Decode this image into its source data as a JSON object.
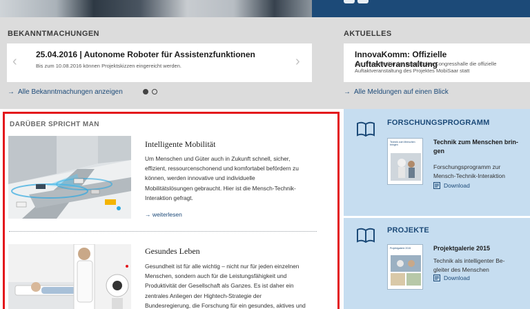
{
  "announcements": {
    "heading": "BEKANNTMACHUNGEN",
    "card_title": "25.04.2016 |  Autonome Roboter für Assistenzfunktionen",
    "card_subtitle": "Bis zum 10.08.2016 können Projektskizzen eingereicht werden.",
    "prev_icon": "chevron-left-icon",
    "next_icon": "chevron-right-icon",
    "prev_glyph": "‹",
    "next_glyph": "›",
    "all_link": "Alle Bekanntmachungen anzeigen",
    "slides_total": 2,
    "slide_active": 1
  },
  "news": {
    "heading": "AKTUELLES",
    "card_title": "InnovaKomm: Offizielle Auftaktveranstaltung",
    "card_subtitle_1": "Am 2. Mai fand in der Saarbrücker Congresshalle die offizielle",
    "card_subtitle_2": "Auftaktveranstaltung des Projektes MobiSaar statt",
    "all_link": "Alle Meldungen auf einen Blick"
  },
  "talk": {
    "heading": "DARÜBER SPRICHT MAN",
    "articles": [
      {
        "title": "Intelligente Mobilität",
        "lines": [
          "Um Menschen und Güter auch in Zukunft schnell, sicher,",
          "effizient, ressourcenschonend und komfortabel befördern zu",
          "können, werden innovative und individuelle",
          "Mobilitätslösungen gebraucht. Hier ist die Mensch-Technik-",
          "Interaktion gefragt."
        ],
        "more": "weiterlesen"
      },
      {
        "title": "Gesundes Leben",
        "lines": [
          "Gesundheit ist für alle wichtig – nicht nur für jeden einzelnen",
          "Menschen, sondern auch für die Leistungsfähigkeit und",
          "Produktivität der Gesellschaft als Ganzes. Es ist daher ein",
          "zentrales Anliegen der Hightech-Strategie der",
          "Bundesregierung, die Forschung für ein gesundes, aktives und"
        ]
      }
    ]
  },
  "sidebar": {
    "program": {
      "heading": "FORSCHUNGSPROGRAMM",
      "title_1": "Technik zum Menschen brin-",
      "title_2": "gen",
      "desc_1": "Forschungsprogramm zur",
      "desc_2": "Mensch-Technik-Interaktion",
      "download": "Download",
      "thumb_caption": "Technik zum Menschen bringen"
    },
    "projects": {
      "heading": "PROJEKTE",
      "title": "Projektgalerie 2015",
      "desc_1": "Technik als intelligenter Be-",
      "desc_2": "gleiter des Menschen",
      "download": "Download",
      "thumb_caption": "Projektgalerie 2015"
    }
  },
  "arrow_glyph": "→",
  "colors": {
    "brand_blue": "#1c4a78",
    "highlight_red": "#e3141b",
    "band_grey": "#dcdcdc",
    "side_blue": "#c6ddf0"
  }
}
